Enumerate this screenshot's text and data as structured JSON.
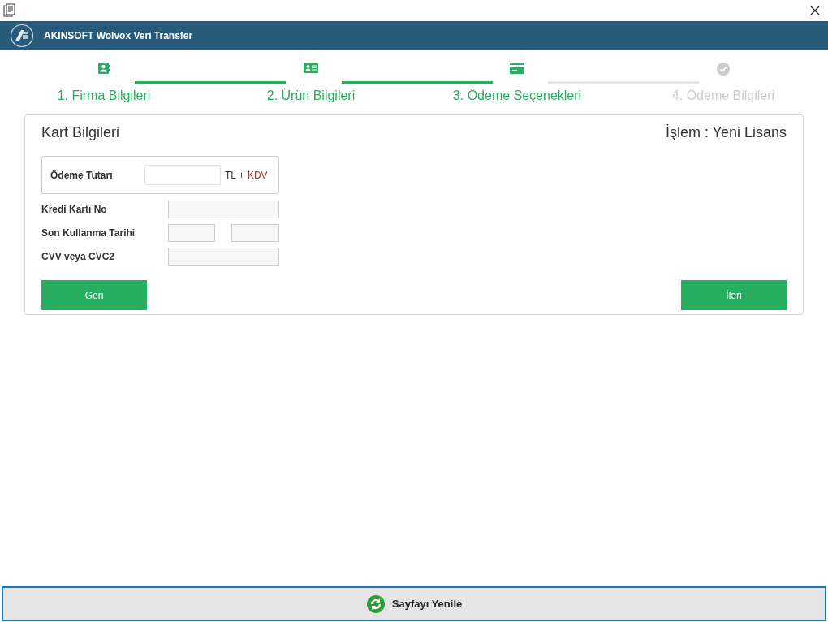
{
  "header": {
    "title": "AKINSOFT Wolvox Veri Transfer"
  },
  "steps": [
    {
      "label": "1. Firma Bilgileri",
      "kind": "contact",
      "completed": true
    },
    {
      "label": "2. Ürün Bilgileri",
      "kind": "id-card",
      "completed": true
    },
    {
      "label": "3. Ödeme Seçenekleri",
      "kind": "card",
      "completed": true
    },
    {
      "label": "4. Ödeme Bilgileri",
      "kind": "check",
      "completed": false
    }
  ],
  "card": {
    "title": "Kart Bilgileri",
    "operation": "İşlem : Yeni Lisans",
    "amount": {
      "label": "Ödeme Tutarı",
      "unit_1": "TL +",
      "unit_2": "KDV"
    },
    "fields": [
      {
        "label": "Kredi Kartı No",
        "kind": "single"
      },
      {
        "label": "Son Kullanma Tarihi",
        "kind": "double"
      },
      {
        "label": "CVV veya CVC2",
        "kind": "single"
      }
    ],
    "back_button": "Geri",
    "next_button": "İleri"
  },
  "refresh_button": "Sayfayı Yenile"
}
